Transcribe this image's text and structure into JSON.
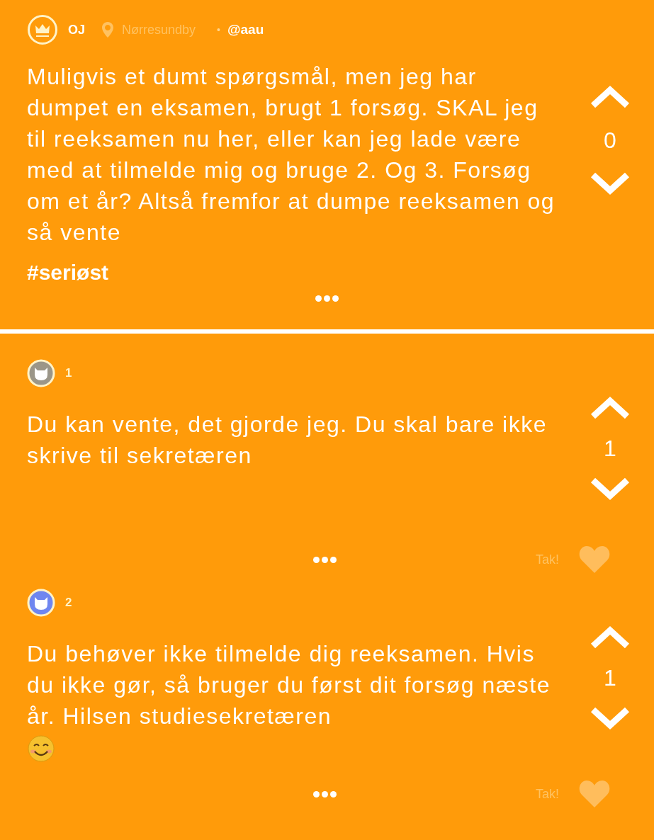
{
  "post": {
    "author": "OJ",
    "location": "Nørresundby",
    "channel": "@aau",
    "separator": "•",
    "text": "Muligvis et dumt spørgsmål, men jeg har dumpet en eksamen, brugt 1 forsøg. SKAL jeg til reeksamen nu her, eller kan jeg lade være med at tilmelde mig og bruge 2. Og 3. Forsøg om et år? Altså fremfor at dumpe reeksamen og så vente",
    "hashtag": "#seriøst",
    "votes": "0"
  },
  "replies": [
    {
      "number": "1",
      "color": "#9b9688",
      "text": "Du kan vente, det gjorde jeg. Du skal bare ikke skrive til sekretæren",
      "emoji": false,
      "votes": "1",
      "thanks": "Tak!"
    },
    {
      "number": "2",
      "color": "#6f86f0",
      "text": "Du behøver ikke tilmelde dig reeksamen. Hvis du ikke gør, så bruger du først dit forsøg næste år. Hilsen studiesekretæren",
      "emoji": true,
      "votes": "1",
      "thanks": "Tak!"
    }
  ]
}
